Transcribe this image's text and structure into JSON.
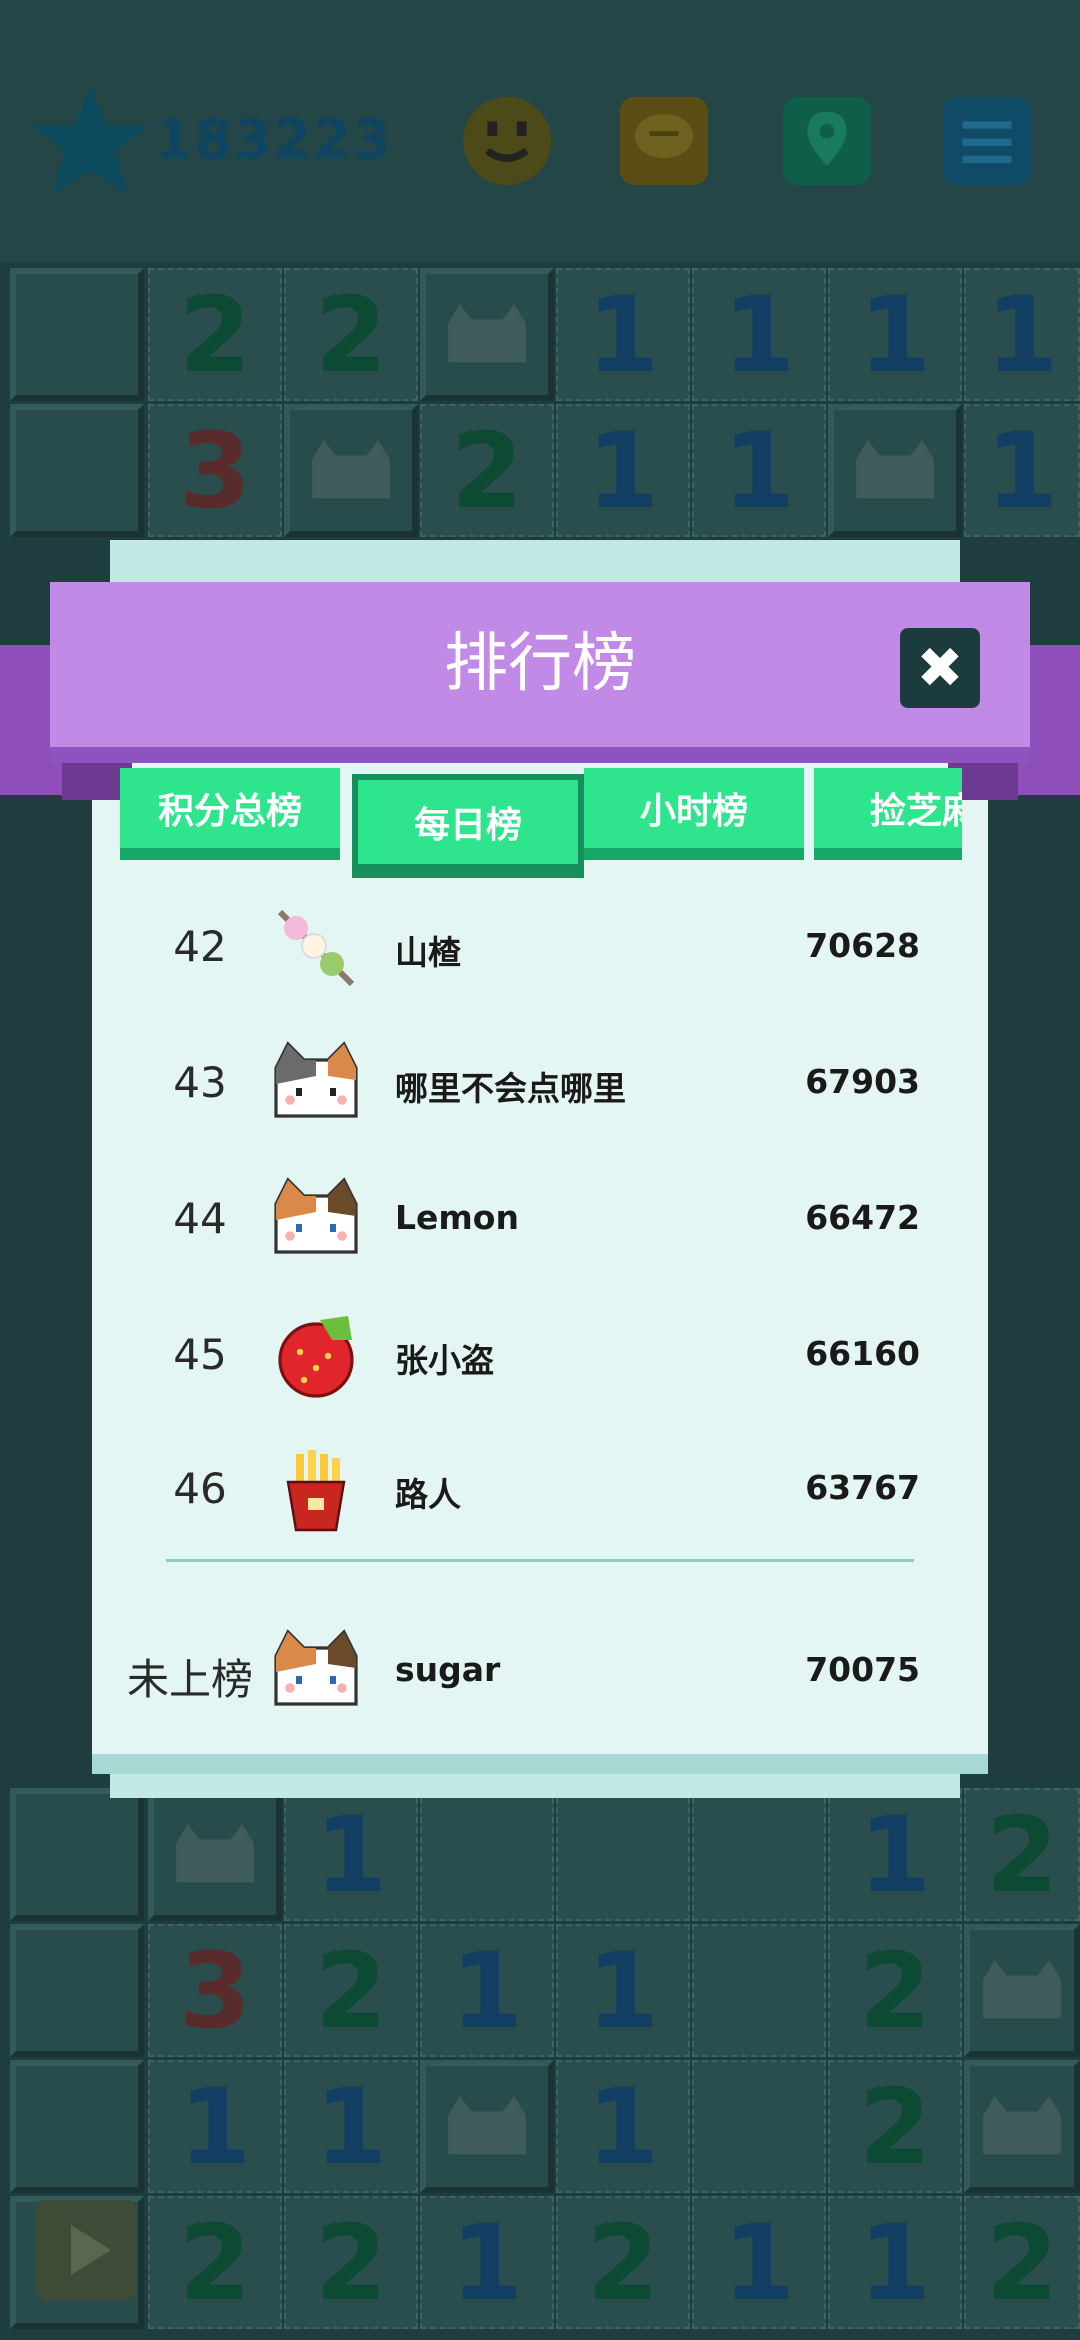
{
  "header": {
    "score": "183223"
  },
  "board_numbers": {
    "row0": [
      "2",
      "2",
      "",
      "1",
      "1",
      "1",
      "1"
    ],
    "row1": [
      "3",
      "",
      "2",
      "1",
      "1",
      "",
      "1"
    ]
  },
  "dialog": {
    "title": "排行榜",
    "tabs": [
      {
        "label": "积分总榜"
      },
      {
        "label": "每日榜"
      },
      {
        "label": "小时榜"
      },
      {
        "label": "捡芝麻"
      }
    ],
    "rows": [
      {
        "rank": "42",
        "name": "山楂",
        "points": "70628",
        "avatar": "skewer-icon"
      },
      {
        "rank": "43",
        "name": "哪里不会点哪里",
        "points": "67903",
        "avatar": "cat-icon"
      },
      {
        "rank": "44",
        "name": "Lemon",
        "points": "66472",
        "avatar": "cat-icon"
      },
      {
        "rank": "45",
        "name": "张小盗",
        "points": "66160",
        "avatar": "strawberry-icon"
      },
      {
        "rank": "46",
        "name": "路人",
        "points": "63767",
        "avatar": "fries-icon"
      }
    ],
    "me": {
      "rank": "未上榜",
      "name": "sugar",
      "points": "70075",
      "avatar": "cat-icon"
    }
  },
  "colors": {
    "ribbon": "#c18ae6",
    "tab": "#2ee48c",
    "panel": "#e3f6f4"
  }
}
